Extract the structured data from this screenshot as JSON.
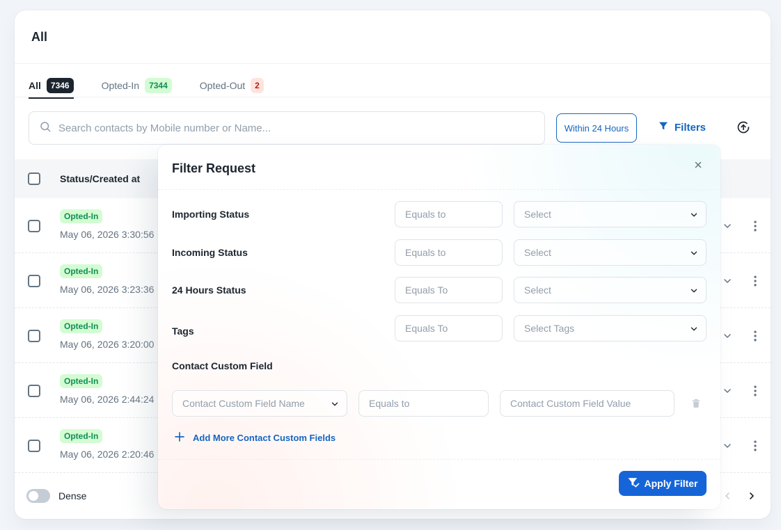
{
  "card": {
    "title": "All"
  },
  "tabs": [
    {
      "label": "All",
      "count": "7346"
    },
    {
      "label": "Opted-In",
      "count": "7344"
    },
    {
      "label": "Opted-Out",
      "count": "2"
    }
  ],
  "toolbar": {
    "search_placeholder": "Search contacts by Mobile number or Name...",
    "within_label": "Within 24 Hours",
    "filters_label": "Filters"
  },
  "table": {
    "header": "Status/Created at",
    "rows": [
      {
        "status": "Opted-In",
        "date": "May 06, 2026 3:30:56"
      },
      {
        "status": "Opted-In",
        "date": "May 06, 2026 3:23:36"
      },
      {
        "status": "Opted-In",
        "date": "May 06, 2026 3:20:00"
      },
      {
        "status": "Opted-In",
        "date": "May 06, 2026 2:44:24"
      },
      {
        "status": "Opted-In",
        "date": "May 06, 2026 2:20:46"
      }
    ]
  },
  "footer": {
    "dense_label": "Dense"
  },
  "filter_popover": {
    "title": "Filter Request",
    "rows": [
      {
        "label": "Importing Status",
        "operator": "Equals to",
        "value_placeholder": "Select"
      },
      {
        "label": "Incoming Status",
        "operator": "Equals to",
        "value_placeholder": "Select"
      },
      {
        "label": "24 Hours Status",
        "operator": "Equals To",
        "value_placeholder": "Select"
      },
      {
        "label": "Tags",
        "operator": "Equals To",
        "value_placeholder": "Select Tags"
      }
    ],
    "custom_field": {
      "label": "Contact Custom Field",
      "name_placeholder": "Contact Custom Field Name",
      "operator": "Equals to",
      "value_placeholder": "Contact Custom Field Value"
    },
    "add_more_label": "Add More Contact Custom Fields",
    "apply_label": "Apply Filter"
  },
  "colors": {
    "primary": "#1565c0",
    "apply_button": "#1565d8",
    "opted_in_bg": "#d3fcd2",
    "opted_in_text": "#118d57",
    "opted_out_bg": "#ffe4de",
    "opted_out_text": "#b71d18"
  }
}
